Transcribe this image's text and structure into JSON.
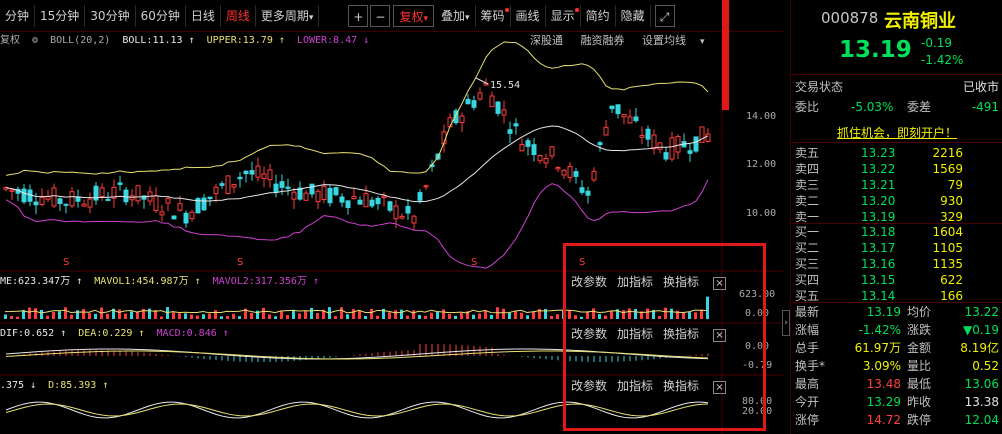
{
  "toolbar": {
    "periods": [
      "分钟",
      "15分钟",
      "30分钟",
      "60分钟",
      "日线",
      "周线",
      "更多周期"
    ],
    "active_period": "周线",
    "plus": "+",
    "minus": "−",
    "fuquan": "复权",
    "diejia": "叠加",
    "chouma": "筹码",
    "huaxian": "画线",
    "xianshi": "显示",
    "jianyue": "简约",
    "yincang": "隐藏",
    "caret": "▾"
  },
  "boll": {
    "fuquan": "复权",
    "name": "BOLL(20,2)",
    "boll": "BOLL:11.13 ↑",
    "upper": "UPPER:13.79 ↑",
    "lower": "LOWER:8.47 ↓"
  },
  "chart_links": [
    "深股通",
    "融资融券",
    "设置均线"
  ],
  "axis": {
    "p14": "14.00",
    "p12": "12.00",
    "p10": "10.00",
    "peak": "15.54"
  },
  "vol": {
    "label1": "ME:623.347万 ↑",
    "label2": "MAVOL1:454.987万 ↑",
    "label3": "MAVOL2:317.356万 ↑",
    "axis_top": "623.00",
    "axis_bot": "0.00"
  },
  "macd": {
    "label1": "DIF:0.652 ↑",
    "label2": "DEA:0.229 ↑",
    "label3": "MACD:0.846 ↑",
    "axis_top": "0.00",
    "axis_bot": "-0.79"
  },
  "kdj": {
    "label1": ".375 ↓",
    "label2": "D:85.393 ↑",
    "axis_top": "80.00",
    "axis_bot": "20.00"
  },
  "sub_ctrl": {
    "params": "改参数",
    "add": "加指标",
    "switch": "换指标",
    "close": "×"
  },
  "stock": {
    "code": "000878",
    "name": "云南铜业",
    "price": "13.19",
    "change": "-0.19",
    "change_pct": "-1.42%"
  },
  "status": {
    "label": "交易状态",
    "value": "已收市"
  },
  "weibi": {
    "label": "委比",
    "value": "-5.03%",
    "label2": "委差",
    "value2": "-491"
  },
  "promo": "抓住机会，即刻开户！",
  "asks": [
    {
      "label": "卖五",
      "price": "13.23",
      "vol": "2216"
    },
    {
      "label": "卖四",
      "price": "13.22",
      "vol": "1569"
    },
    {
      "label": "卖三",
      "price": "13.21",
      "vol": "79"
    },
    {
      "label": "卖二",
      "price": "13.20",
      "vol": "930"
    },
    {
      "label": "卖一",
      "price": "13.19",
      "vol": "329"
    }
  ],
  "bids": [
    {
      "label": "买一",
      "price": "13.18",
      "vol": "1604"
    },
    {
      "label": "买二",
      "price": "13.17",
      "vol": "1105"
    },
    {
      "label": "买三",
      "price": "13.16",
      "vol": "1135"
    },
    {
      "label": "买四",
      "price": "13.15",
      "vol": "622"
    },
    {
      "label": "买五",
      "price": "13.14",
      "vol": "166"
    }
  ],
  "stats": [
    {
      "l1": "最新",
      "v1": "13.19",
      "c1": "#00e05a",
      "l2": "均价",
      "v2": "13.22",
      "c2": "#00e05a"
    },
    {
      "l1": "涨幅",
      "v1": "-1.42%",
      "c1": "#00e05a",
      "l2": "涨跌",
      "v2": "▼0.19",
      "c2": "#00e05a"
    },
    {
      "l1": "总手",
      "v1": "61.97万",
      "c1": "#f0f000",
      "l2": "金额",
      "v2": "8.19亿",
      "c2": "#f0f000"
    },
    {
      "l1": "换手*",
      "v1": "3.09%",
      "c1": "#f0f000",
      "l2": "量比",
      "v2": "0.52",
      "c2": "#f0f000"
    },
    {
      "l1": "最高",
      "v1": "13.48",
      "c1": "#ff4040",
      "l2": "最低",
      "v2": "13.06",
      "c2": "#00e05a"
    },
    {
      "l1": "今开",
      "v1": "13.29",
      "c1": "#00e05a",
      "l2": "昨收",
      "v2": "13.38",
      "c2": "#e0e0e0"
    },
    {
      "l1": "涨停",
      "v1": "14.72",
      "c1": "#ff4040",
      "l2": "跌停",
      "v2": "12.04",
      "c2": "#00e05a"
    }
  ],
  "colors": {
    "up": "#ff3c3c",
    "down": "#36d7e0",
    "mid": "#e8e8e8",
    "upper": "#e8e070",
    "lower": "#d040d0",
    "accent": "#e01818"
  }
}
